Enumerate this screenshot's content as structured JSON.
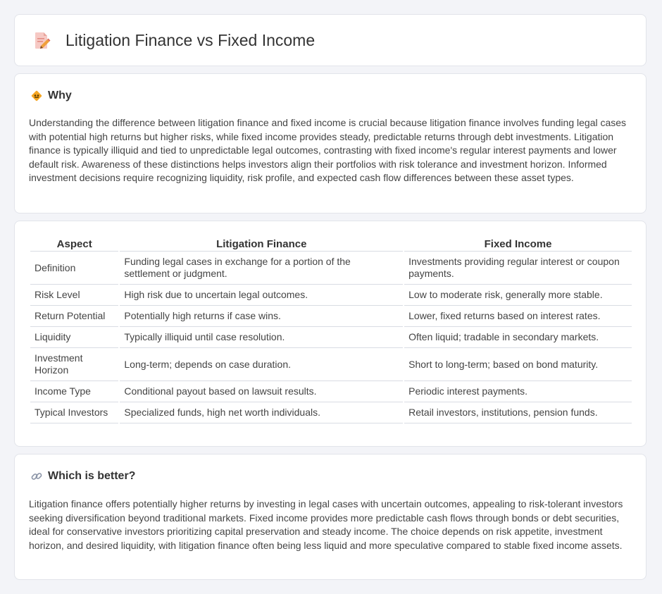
{
  "header": {
    "title": "Litigation Finance vs Fixed Income",
    "icon": "document-pencil-icon"
  },
  "why": {
    "title": "Why",
    "icon": "diamond-sign-icon",
    "body": "Understanding the difference between litigation finance and fixed income is crucial because litigation finance involves funding legal cases with potential high returns but higher risks, while fixed income provides steady, predictable returns through debt investments. Litigation finance is typically illiquid and tied to unpredictable legal outcomes, contrasting with fixed income's regular interest payments and lower default risk. Awareness of these distinctions helps investors align their portfolios with risk tolerance and investment horizon. Informed investment decisions require recognizing liquidity, risk profile, and expected cash flow differences between these asset types."
  },
  "table": {
    "headers": [
      "Aspect",
      "Litigation Finance",
      "Fixed Income"
    ],
    "rows": [
      [
        "Definition",
        "Funding legal cases in exchange for a portion of the settlement or judgment.",
        "Investments providing regular interest or coupon payments."
      ],
      [
        "Risk Level",
        "High risk due to uncertain legal outcomes.",
        "Low to moderate risk, generally more stable."
      ],
      [
        "Return Potential",
        "Potentially high returns if case wins.",
        "Lower, fixed returns based on interest rates."
      ],
      [
        "Liquidity",
        "Typically illiquid until case resolution.",
        "Often liquid; tradable in secondary markets."
      ],
      [
        "Investment Horizon",
        "Long-term; depends on case duration.",
        "Short to long-term; based on bond maturity."
      ],
      [
        "Income Type",
        "Conditional payout based on lawsuit results.",
        "Periodic interest payments."
      ],
      [
        "Typical Investors",
        "Specialized funds, high net worth individuals.",
        "Retail investors, institutions, pension funds."
      ]
    ]
  },
  "better": {
    "title": "Which is better?",
    "icon": "link-icon",
    "body": "Litigation finance offers potentially higher returns by investing in legal cases with uncertain outcomes, appealing to risk-tolerant investors seeking diversification beyond traditional markets. Fixed income provides more predictable cash flows through bonds or debt securities, ideal for conservative investors prioritizing capital preservation and steady income. The choice depends on risk appetite, investment horizon, and desired liquidity, with litigation finance often being less liquid and more speculative compared to stable fixed income assets."
  }
}
